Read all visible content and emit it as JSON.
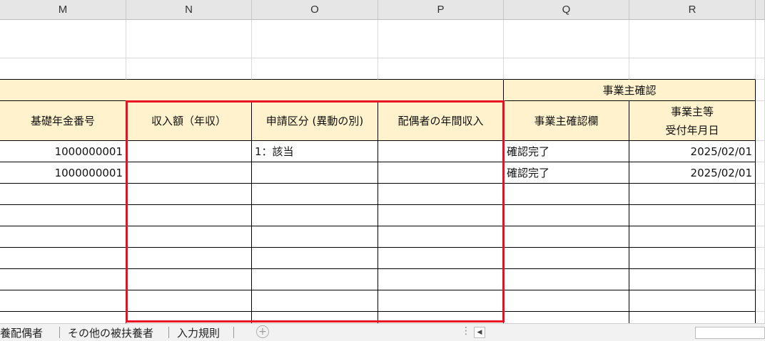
{
  "columns": [
    "M",
    "N",
    "O",
    "P",
    "Q",
    "R"
  ],
  "header_group": {
    "employer_confirm": "事業主確認"
  },
  "headers": {
    "basic_pension_number": "基礎年金番号",
    "income_annual": "収入額（年収）",
    "application_category": "申請区分 (異動の別)",
    "spouse_annual_income": "配偶者の年間収入",
    "employer_confirm_field": "事業主確認欄",
    "employer_date_line1": "事業主等",
    "employer_date_line2": "受付年月日"
  },
  "rows": [
    {
      "pension": "1000000001",
      "income": "",
      "category": "1：該当",
      "spouse_income": "",
      "confirm": "確認完了",
      "date": "2025/02/01"
    },
    {
      "pension": "1000000001",
      "income": "",
      "category": "",
      "spouse_income": "",
      "confirm": "確認完了",
      "date": "2025/02/01"
    }
  ],
  "sheet_tabs": [
    "養配偶者",
    "その他の被扶養者",
    "入力規則"
  ],
  "add_sheet_symbol": "+",
  "dots_symbol": "⋮",
  "scroll_left_symbol": "◀"
}
